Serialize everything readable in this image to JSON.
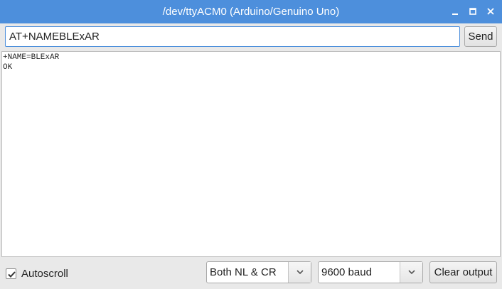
{
  "window": {
    "title": "/dev/ttyACM0 (Arduino/Genuino Uno)"
  },
  "input": {
    "value": "AT+NAMEBLExAR",
    "send_label": "Send"
  },
  "output": {
    "lines": [
      "+NAME=BLExAR",
      "OK"
    ]
  },
  "footer": {
    "autoscroll_label": "Autoscroll",
    "autoscroll_checked": true,
    "line_ending": "Both NL & CR",
    "baud_rate": "9600 baud",
    "clear_label": "Clear output"
  },
  "colors": {
    "titlebar": "#4d8fdc",
    "input_border": "#4d8fdc"
  }
}
